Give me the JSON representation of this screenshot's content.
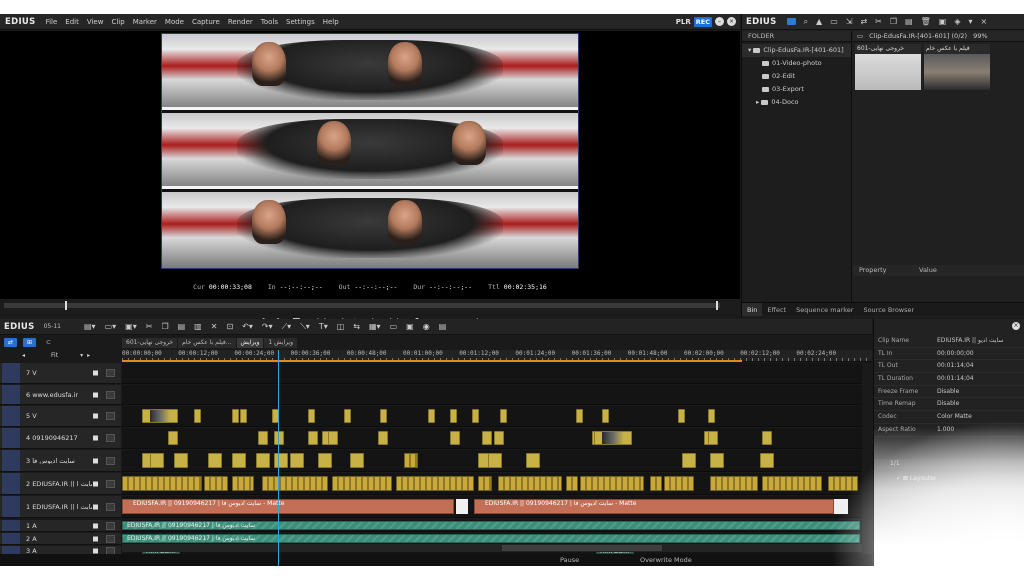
{
  "app": {
    "brand": "EDIUS",
    "menu": [
      "File",
      "Edit",
      "View",
      "Clip",
      "Marker",
      "Mode",
      "Capture",
      "Render",
      "Tools",
      "Settings",
      "Help"
    ],
    "plr_label": "PLR",
    "rec_label": "REC"
  },
  "player": {
    "timecodes": {
      "cur_label": "Cur",
      "cur_value": "00:00:33;08",
      "in_label": "In",
      "in_value": "--:--:--;--",
      "out_label": "Out",
      "out_value": "--:--:--;--",
      "dur_label": "Dur",
      "dur_value": "--:--:--;--",
      "ttl_label": "Ttl",
      "ttl_value": "00:02:35;16"
    }
  },
  "bin": {
    "brand": "EDIUS",
    "folder_header": "FOLDER",
    "tree": [
      {
        "label": "Clip-EdusFa.IR-[401-601]",
        "selected": true
      },
      {
        "label": "01-Video-photo"
      },
      {
        "label": "02-Edit"
      },
      {
        "label": "03-Export"
      },
      {
        "label": "04-Doco"
      }
    ],
    "clip_header_path": "Clip-EdusFa.IR-[401-601] (0/2)",
    "clip_header_pct": "99%",
    "thumbs": [
      {
        "caption": "خروجی نهایی-601"
      },
      {
        "caption": "فیلم با عکس خام"
      }
    ],
    "property_label": "Property",
    "value_label": "Value",
    "tabs": [
      "Bin",
      "Effect",
      "Sequence marker",
      "Source Browser"
    ]
  },
  "timeline": {
    "brand": "EDIUS",
    "sequence_num": "05-11",
    "fit_label": "Fit",
    "tabs": [
      "خروجی نهایی-601",
      "فیلم با عکس خام...",
      "ویرایش",
      "ویرایش 1"
    ],
    "ruler_labels": [
      "00:00:00;00",
      "00:00:12;00",
      "00:00:24;00",
      "00:00:36;00",
      "00:00:48;00",
      "00:01:00;00",
      "00:01:12;00",
      "00:01:24;00",
      "00:01:36;00",
      "00:01:48;00",
      "00:02:00;00",
      "00:02:12;00",
      "00:02:24;00"
    ],
    "tracks": [
      {
        "label": "7 V"
      },
      {
        "label": "6 www.edusfa.ir"
      },
      {
        "label": "5 V"
      },
      {
        "label": "4 09190946217"
      },
      {
        "label": "3 سایت ادیوس فا"
      },
      {
        "label": "2 EDIUSFA.IR || سایت ا"
      },
      {
        "label": "1 EDIUSFA.IR || سایت ا"
      },
      {
        "label": "1 A"
      },
      {
        "label": "2 A"
      },
      {
        "label": "3 A"
      }
    ],
    "side_labels": [
      "V",
      "A",
      "V",
      "A1",
      "A2",
      "A3"
    ],
    "red_bar_1": "EDIUSFA.IR || 09190946217 | سایت ادیوس فا  - Matte",
    "red_bar_2": "EDIUSFA.IR || 09190946217 | سایت ادیوس فا  - Matte",
    "audio_1": "EDIUSFA.IR || 09190946217 | سایت ادیوس فا",
    "audio_2": "EDIUSFA.IR || 09190946217 | سایت ادیوس فا",
    "film_bur_1": "Film-Bur...",
    "film_bur_2": "Film-Bur...",
    "status_pause": "Pause",
    "status_mode": "Overwrite Mode"
  },
  "info": {
    "rows": [
      {
        "k": "Clip Name",
        "v": "EDIUSFA.IR || سایت ادیو"
      },
      {
        "k": "TL In",
        "v": "00:00:00;00"
      },
      {
        "k": "TL Out",
        "v": "00:01:14;04"
      },
      {
        "k": "TL Duration",
        "v": "00:01:14;04"
      },
      {
        "k": "Freeze Frame",
        "v": "Disable"
      },
      {
        "k": "Time Remap",
        "v": "Disable"
      },
      {
        "k": "Codec",
        "v": "Color Matte"
      },
      {
        "k": "Aspect Ratio",
        "v": "1.000"
      }
    ],
    "layouter_count": "1/1",
    "layouter_label": "Layouter"
  }
}
